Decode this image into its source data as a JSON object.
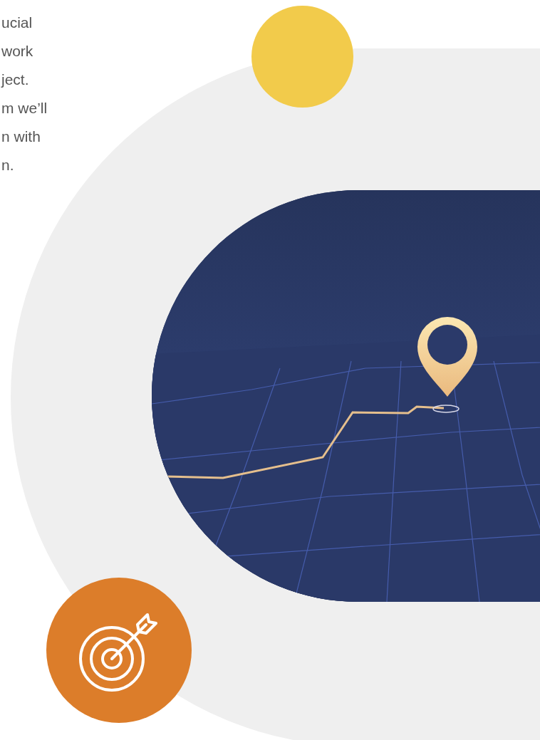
{
  "intro_text": {
    "lines": [
      "ucial",
      "work",
      "ject.",
      "m we’ll",
      "n with",
      "n."
    ]
  }
}
